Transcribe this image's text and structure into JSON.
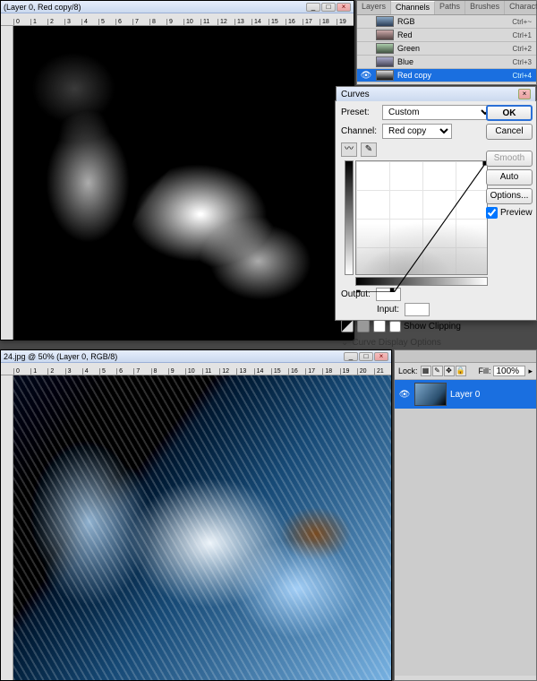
{
  "doc1": {
    "title": "(Layer 0, Red copy/8)",
    "ruler": [
      "0",
      "1",
      "2",
      "3",
      "4",
      "5",
      "6",
      "7",
      "8",
      "9",
      "10",
      "11",
      "12",
      "13",
      "14",
      "15",
      "16",
      "17",
      "18",
      "19"
    ]
  },
  "doc2": {
    "title": "24.jpg @ 50% (Layer 0, RGB/8)",
    "ruler": [
      "0",
      "1",
      "2",
      "3",
      "4",
      "5",
      "6",
      "7",
      "8",
      "9",
      "10",
      "11",
      "12",
      "13",
      "14",
      "15",
      "16",
      "17",
      "18",
      "19",
      "20",
      "21"
    ]
  },
  "channels": {
    "tabs": [
      "Layers",
      "Channels",
      "Paths",
      "Brushes",
      "Character"
    ],
    "active_tab": "Channels",
    "rows": [
      {
        "name": "RGB",
        "shortcut": "Ctrl+~",
        "eye": ""
      },
      {
        "name": "Red",
        "shortcut": "Ctrl+1",
        "eye": ""
      },
      {
        "name": "Green",
        "shortcut": "Ctrl+2",
        "eye": ""
      },
      {
        "name": "Blue",
        "shortcut": "Ctrl+3",
        "eye": ""
      },
      {
        "name": "Red copy",
        "shortcut": "Ctrl+4",
        "eye": "👁"
      }
    ],
    "selected_index": 4
  },
  "curves": {
    "title": "Curves",
    "preset_label": "Preset:",
    "preset": "Custom",
    "channel_label": "Channel:",
    "channel": "Red copy",
    "output_label": "Output:",
    "input_label": "Input:",
    "output_value": "",
    "input_value": "",
    "show_clipping_label": "Show Clipping",
    "show_clipping": false,
    "display_options_label": "Curve Display Options",
    "buttons": {
      "ok": "OK",
      "cancel": "Cancel",
      "smooth": "Smooth",
      "auto": "Auto",
      "options": "Options...",
      "preview_label": "Preview",
      "preview": true
    },
    "curve_points": [
      [
        0,
        255
      ],
      [
        74,
        255
      ],
      [
        255,
        0
      ]
    ]
  },
  "layers_panel": {
    "lock_label": "Lock:",
    "fill_label": "Fill:",
    "fill_value": "100%",
    "layer_name": "Layer 0"
  }
}
